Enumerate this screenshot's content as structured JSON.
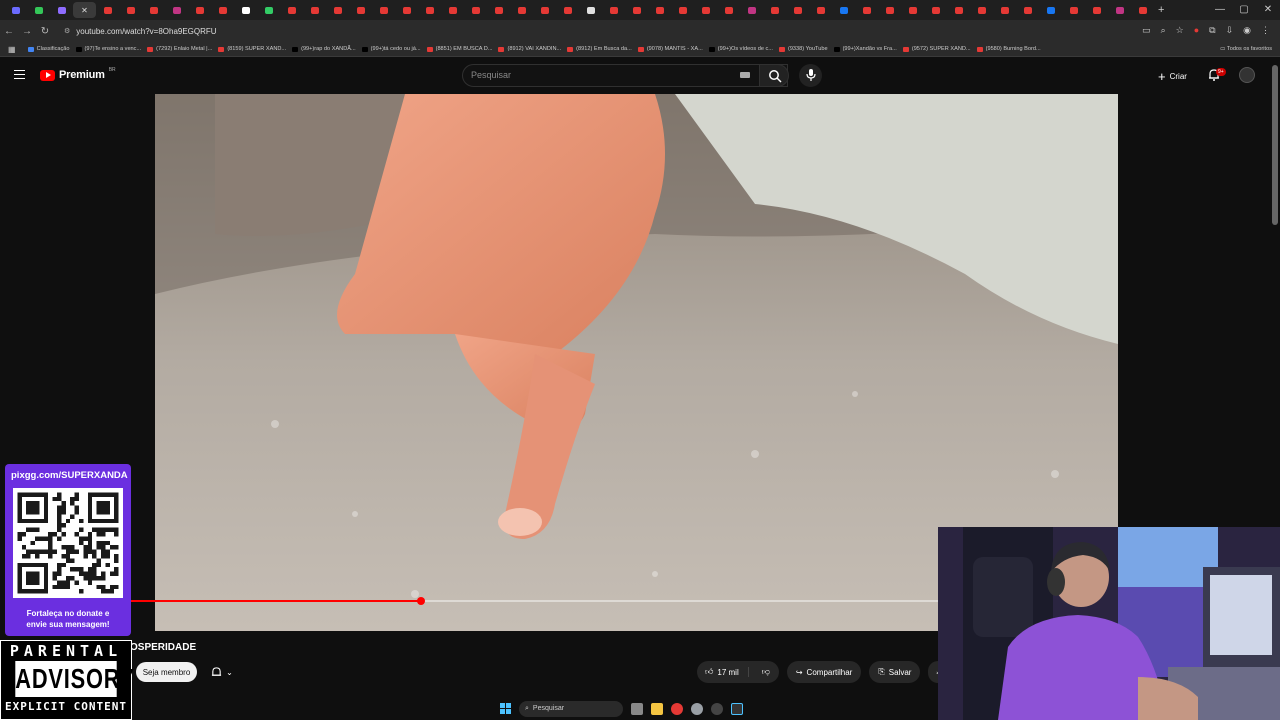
{
  "browser": {
    "url": "youtube.com/watch?v=8Oha9EGQRFU",
    "tab_favicons": [
      "c1",
      "c2",
      "c3",
      "active",
      "yt",
      "yt",
      "yt",
      "c4",
      "yt",
      "yt",
      "c5",
      "c6",
      "yt",
      "yt",
      "yt",
      "yt",
      "yt",
      "yt",
      "yt",
      "yt",
      "yt",
      "yt",
      "yt",
      "yt",
      "yt",
      "c8",
      "yt",
      "yt",
      "yt",
      "yt",
      "yt",
      "yt",
      "c4",
      "yt",
      "yt",
      "yt",
      "c7",
      "yt",
      "yt",
      "yt",
      "yt",
      "yt",
      "yt",
      "yt",
      "yt",
      "c7",
      "yt",
      "yt",
      "c4",
      "yt"
    ],
    "window_controls": [
      "—",
      "▢",
      "✕"
    ]
  },
  "bookmarks": [
    {
      "label": "Classificação",
      "color": "#4285f4"
    },
    {
      "label": "(97)Te ensino a venc...",
      "color": "#000"
    },
    {
      "label": "(7292) Enlaio Metal |...",
      "color": "#e53935"
    },
    {
      "label": "(8159) SUPER XAND...",
      "color": "#e53935"
    },
    {
      "label": "(99+)rap do XANDÃ...",
      "color": "#000"
    },
    {
      "label": "(99+)tá cedo ou já...",
      "color": "#000"
    },
    {
      "label": "(8851) EM BUSCA D...",
      "color": "#e53935"
    },
    {
      "label": "(8912) VAI XANDIN...",
      "color": "#e53935"
    },
    {
      "label": "(8912) Em Busca da...",
      "color": "#e53935"
    },
    {
      "label": "(9078) MANTIS - XA...",
      "color": "#e53935"
    },
    {
      "label": "(99+)Os vídeos de c...",
      "color": "#000"
    },
    {
      "label": "(9338) YouTube",
      "color": "#e53935"
    },
    {
      "label": "(99+)Xandão vs Fra...",
      "color": "#000"
    },
    {
      "label": "(9572) SUPER XAND...",
      "color": "#e53935"
    },
    {
      "label": "(9580) Burning Bord...",
      "color": "#e53935"
    }
  ],
  "bookmarks_right": "Todos os favoritos",
  "youtube": {
    "logo_text": "Premium",
    "logo_sup": "BR",
    "search_placeholder": "Pesquisar",
    "criar_label": "Criar",
    "notif_badge": "9+",
    "video_title_visible": "OSPERIDADE",
    "progress_fraction": 0.36,
    "member_label": "Seja membro",
    "likes": "17 mil",
    "share_label": "Compartilhar",
    "save_label": "Salvar"
  },
  "overlay": {
    "pix_url": "pixgg.com/SUPERXANDA",
    "pix_msg_line1": "Fortaleça no donate e",
    "pix_msg_line2": "envie sua mensagem!",
    "advisory_1": "PARENTAL",
    "advisory_2": "ADVISORY",
    "advisory_3": "EXPLICIT CONTENT"
  },
  "taskbar": {
    "search_label": "Pesquisar"
  }
}
